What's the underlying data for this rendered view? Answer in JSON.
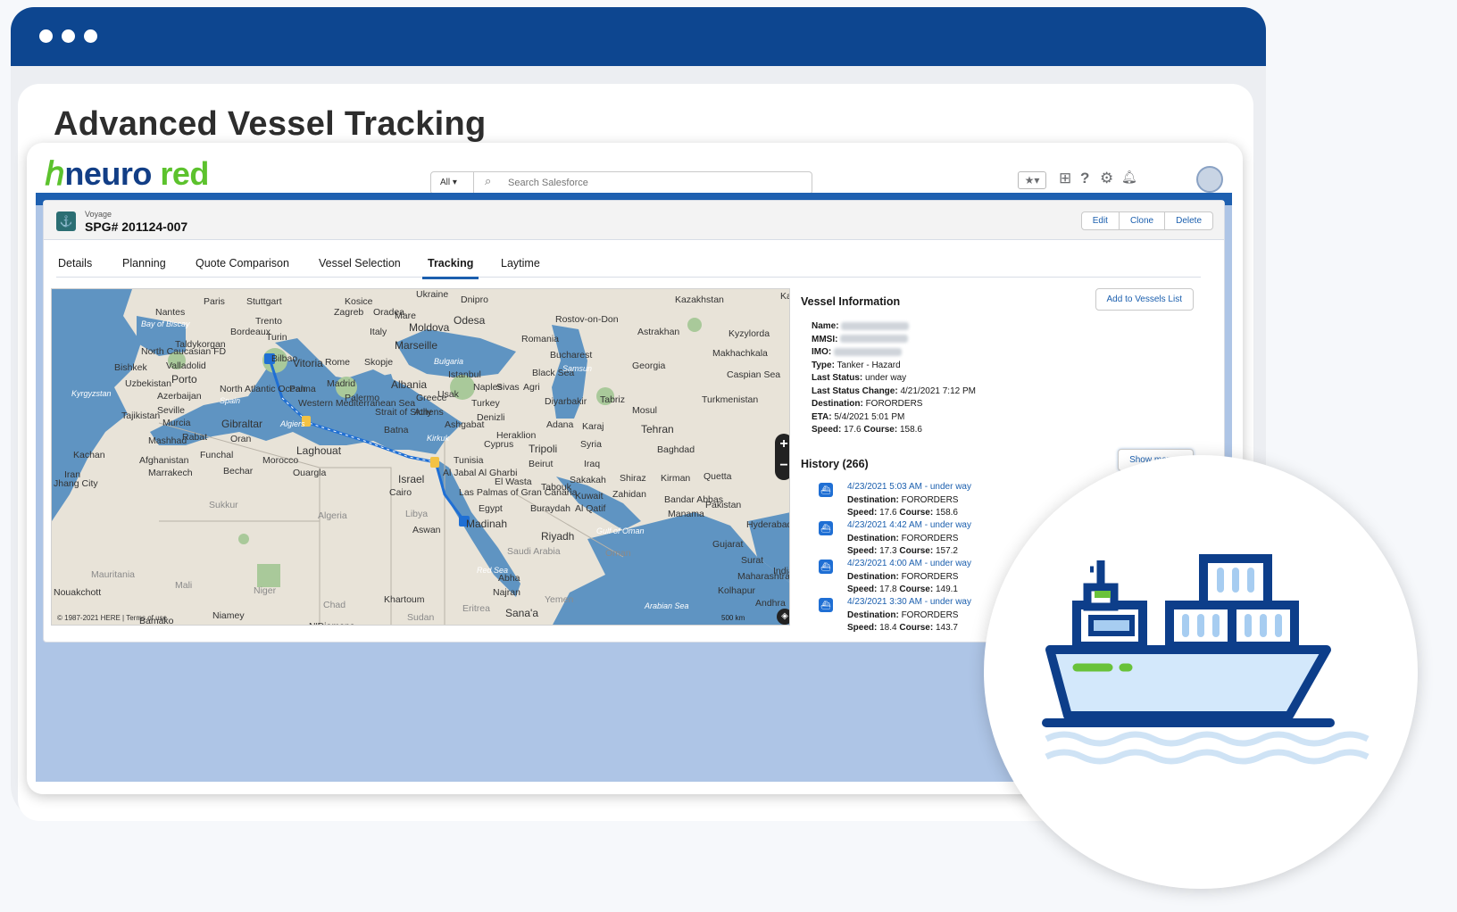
{
  "page": {
    "title": "Advanced Vessel Tracking"
  },
  "brand": {
    "logo_text_a": "neuro",
    "logo_text_b": " red"
  },
  "search": {
    "scope": "All",
    "placeholder": "Search Salesforce"
  },
  "record": {
    "type_label": "Voyage",
    "title": "SPG# 201124-007",
    "actions": [
      "Edit",
      "Clone",
      "Delete"
    ]
  },
  "tabs": [
    "Details",
    "Planning",
    "Quote Comparison",
    "Vessel Selection",
    "Tracking",
    "Laytime"
  ],
  "active_tab": "Tracking",
  "map": {
    "copyright": "© 1987-2021 HERE | Terms of use",
    "scale": "500 km",
    "labels": [
      "Nantes",
      "Paris",
      "Stuttgart",
      "Kosice",
      "Ukraine",
      "Dnipro",
      "Kazakhstan",
      "Ka",
      "Bay of Biscay",
      "Trento",
      "Zagreb",
      "Oradea",
      "Mare",
      "Moldova",
      "Odesa",
      "Rostov-on-Don",
      "Astrakhan",
      "Kyzylorda",
      "Taldykorgan",
      "Bordeaux",
      "Turin",
      "Italy",
      "Romania",
      "North Caucasian FD",
      "Bilbao",
      "Marseille",
      "Bucharest",
      "Makhachkala",
      "Bishkek",
      "Valladolid",
      "Vitoria",
      "Rome",
      "Skopje",
      "Bulgaria",
      "Black Sea",
      "Georgia",
      "Uzbekistan",
      "Porto",
      "Madrid",
      "Albania",
      "Istanbul",
      "Samsun",
      "Caspian Sea",
      "Kyrgyzstan",
      "North Atlantic Ocean",
      "Palma",
      "Naples",
      "Sivas",
      "Agri",
      "Azerbaijan",
      "Spain",
      "Western Mediterranean Sea",
      "Palermo",
      "Greece",
      "Usak",
      "Turkey",
      "Diyarbakir",
      "Tabriz",
      "Turkmenistan",
      "Tajikistan",
      "Seville",
      "Murcia",
      "Gibraltar",
      "Algiers",
      "Strait of Sicily",
      "Athens",
      "Denizli",
      "Mosul",
      "Ashgabat",
      "Adana",
      "Karaj",
      "Tehran",
      "Mashhad",
      "Rabat",
      "Oran",
      "Batna",
      "Heraklion",
      "Kirkuk",
      "Cyprus",
      "Syria",
      "Kachan",
      "Funchal",
      "Laghouat",
      "Tripoli",
      "Baghdad",
      "Afghanistan",
      "Morocco",
      "Tunisia",
      "Beirut",
      "Iraq",
      "Iran",
      "Marrakech",
      "Bechar",
      "Ouargla",
      "Al Jabal Al Gharbi",
      "Israel",
      "Cairo",
      "El Wasta",
      "Sakakah",
      "Shiraz",
      "Kirman",
      "Quetta",
      "Jhang City",
      "Las Palmas of Gran Canaria",
      "Tabouk",
      "Kuwait",
      "Zahidan",
      "Bandar Abbas",
      "Sukkur",
      "Algeria",
      "Libya",
      "Egypt",
      "Buraydah",
      "Al Qatif",
      "Manama",
      "Pakistan",
      "Hyderabad",
      "Aswan",
      "Madinah",
      "Gulf of Oman",
      "Riyadh",
      "Saudi Arabia",
      "Oman",
      "Mauritania",
      "Mali",
      "Niger",
      "Red Sea",
      "Abha",
      "Najran",
      "Surat",
      "Nouakchott",
      "Chad",
      "Khartoum",
      "Yemen",
      "Kolhapur",
      "Arabian Sea",
      "Sudan",
      "Sana'a",
      "Eritrea",
      "Bamako",
      "Niamey",
      "N'Djamena",
      "Gujarat",
      "Maharashtra",
      "India",
      "Andhra"
    ]
  },
  "vessel_info": {
    "title": "Vessel Information",
    "add_button": "Add to Vessels List",
    "fields": [
      {
        "label": "Name:",
        "value": ""
      },
      {
        "label": "MMSI:",
        "value": ""
      },
      {
        "label": "IMO:",
        "value": ""
      },
      {
        "label": "Type:",
        "value": "Tanker - Hazard"
      },
      {
        "label": "Last Status:",
        "value": "under way"
      },
      {
        "label": "Last Status Change:",
        "value": "4/21/2021 7:12 PM"
      },
      {
        "label": "Destination:",
        "value": "FORORDERS"
      },
      {
        "label": "ETA:",
        "value": "5/4/2021 5:01 PM"
      },
      {
        "label": "Speed:",
        "value": "17.6"
      },
      {
        "label": "Course:",
        "value": "158.6"
      }
    ]
  },
  "history": {
    "title": "History (266)",
    "show_more": "Show more...",
    "items": [
      {
        "link": "4/23/2021 5:03 AM - under way",
        "destination": "FORORDERS",
        "speed": "17.6",
        "course": "158.6"
      },
      {
        "link": "4/23/2021 4:42 AM - under way",
        "destination": "FORORDERS",
        "speed": "17.3",
        "course": "157.2"
      },
      {
        "link": "4/23/2021 4:00 AM - under way",
        "destination": "FORORDERS",
        "speed": "17.8",
        "course": "149.1"
      },
      {
        "link": "4/23/2021 3:30 AM - under way",
        "destination": "FORORDERS",
        "speed": "18.4",
        "course": "143.7"
      }
    ],
    "labels": {
      "destination": "Destination:",
      "speed": "Speed:",
      "course": "Course:"
    }
  },
  "colors": {
    "header": "#0d4690",
    "accent": "#1b5fae",
    "logo_green": "#5cc22d",
    "ship_navy": "#0d3e8a"
  }
}
